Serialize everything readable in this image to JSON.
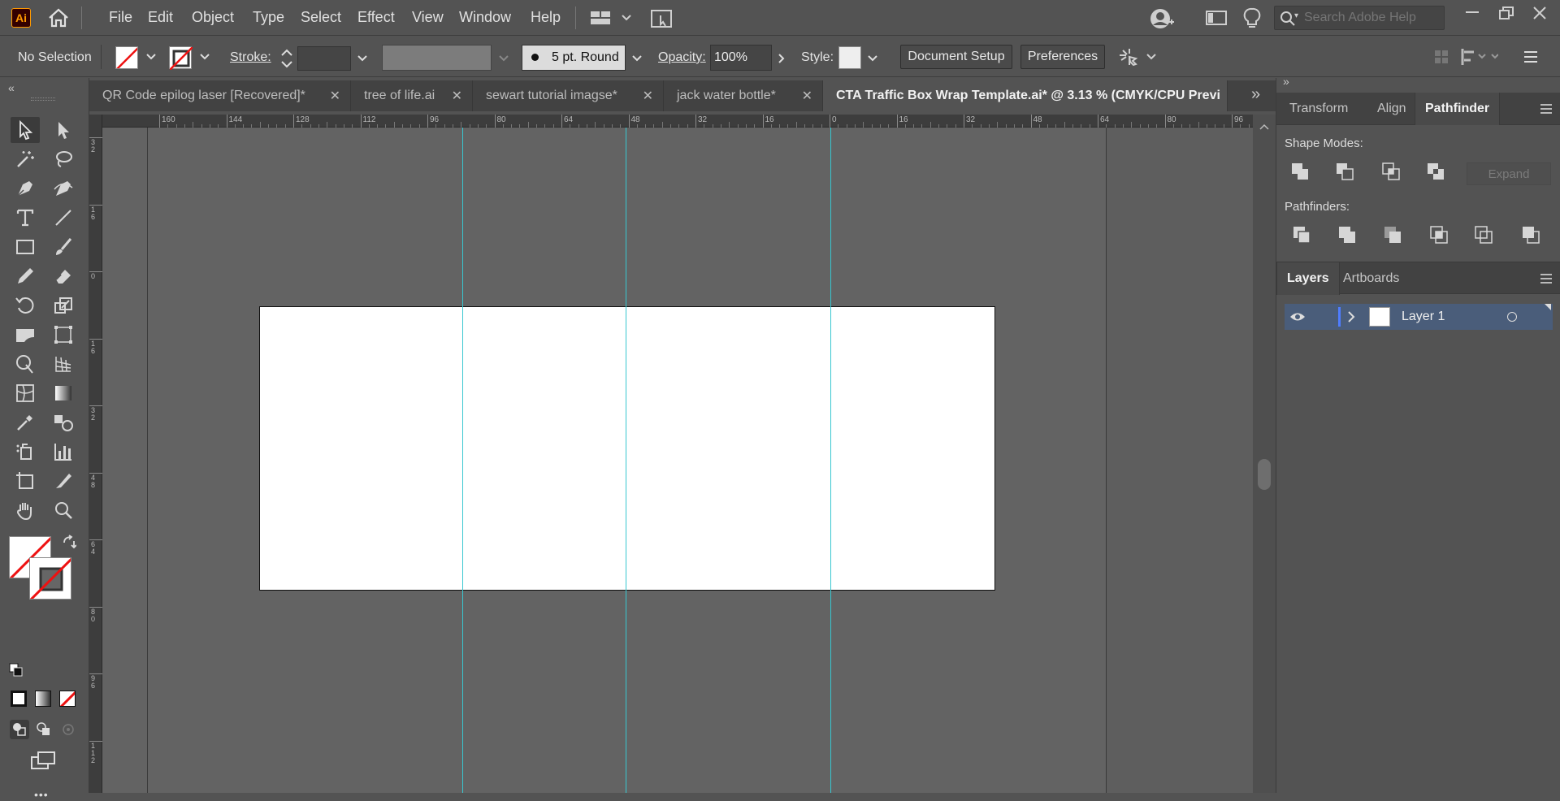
{
  "app": {
    "logo": "Ai"
  },
  "menu": [
    "File",
    "Edit",
    "Object",
    "Type",
    "Select",
    "Effect",
    "View",
    "Window",
    "Help"
  ],
  "search": {
    "placeholder": "Search Adobe Help"
  },
  "control": {
    "selection": "No Selection",
    "stroke_label": "Stroke:",
    "brush": "5 pt. Round",
    "opacity_label": "Opacity:",
    "opacity_value": "100%",
    "style_label": "Style:",
    "document_setup": "Document Setup",
    "preferences": "Preferences"
  },
  "tabs": [
    {
      "label": "QR Code epilog laser [Recovered]*",
      "close": "✕"
    },
    {
      "label": "tree of life.ai",
      "close": "✕"
    },
    {
      "label": "sewart tutorial imagse*",
      "close": "✕"
    },
    {
      "label": "jack water bottle*",
      "close": "✕"
    },
    {
      "label": "CTA Traffic Box Wrap Template.ai* @ 3.13 % (CMYK/CPU Previ",
      "close": ""
    }
  ],
  "tab_overflow": "»",
  "hruler_ticks": [
    "160",
    "144",
    "128",
    "112",
    "96",
    "80",
    "64",
    "48",
    "32",
    "16",
    "0",
    "16",
    "32",
    "48",
    "64",
    "80",
    "96"
  ],
  "vruler_ticks": [
    "3\n2",
    "1\n6",
    "0",
    "1\n6",
    "3\n2",
    "4\n8",
    "6\n4",
    "8\n0",
    "9\n6",
    "1\n1\n2"
  ],
  "panels": {
    "top_tabs": [
      "Transform",
      "Align",
      "Pathfinder"
    ],
    "shape_modes_label": "Shape Modes:",
    "expand": "Expand",
    "pathfinders_label": "Pathfinders:",
    "bottom_tabs": [
      "Layers",
      "Artboards"
    ],
    "layer_name": "Layer 1"
  },
  "more_tools": "•••",
  "colors": {
    "accent_guide": "#38c7d0",
    "layer_highlight": "#4a5d7a",
    "layer_color_bar": "#4f7dff"
  }
}
